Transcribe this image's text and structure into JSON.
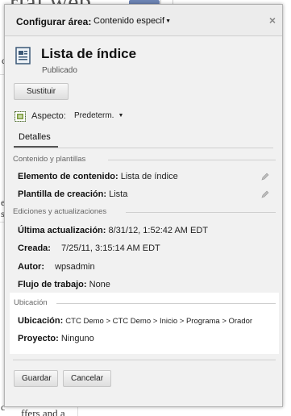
{
  "dialog": {
    "title_label": "Configurar área:",
    "title_select": "Contenido especif",
    "item_title": "Lista de índice",
    "item_status": "Publicado",
    "replace_button": "Sustituir",
    "aspect_label": "Aspecto:",
    "aspect_value": "Predeterm.",
    "tab_details": "Detalles"
  },
  "content_section": {
    "title": "Contenido y plantillas",
    "content_element_label": "Elemento de contenido:",
    "content_element_value": "Lista de índice",
    "template_label": "Plantilla de creación:",
    "template_value": "Lista"
  },
  "editions_section": {
    "title": "Ediciones y actualizaciones",
    "last_update_label": "Última actualización:",
    "last_update_value": "8/31/12, 1:52:42 AM EDT",
    "created_label": "Creada:",
    "created_value": "7/25/11, 3:15:14 AM EDT",
    "author_label": "Autor:",
    "author_value": "wpsadmin",
    "workflow_label": "Flujo de trabajo:",
    "workflow_value": "None"
  },
  "location_section": {
    "title": "Ubicación",
    "location_label": "Ubicación:",
    "location_value": "CTC Demo > CTC Demo > Inicio > Programa > Orador",
    "project_label": "Proyecto:",
    "project_value": "Ninguno"
  },
  "footer": {
    "save_button": "Guardar",
    "cancel_button": "Cancelar"
  },
  "background": {
    "heading": "rial web",
    "left_c1": "c",
    "left_e": "e",
    "left_s": "s",
    "left_c2": "c",
    "bottom_text": "ffers and a"
  }
}
